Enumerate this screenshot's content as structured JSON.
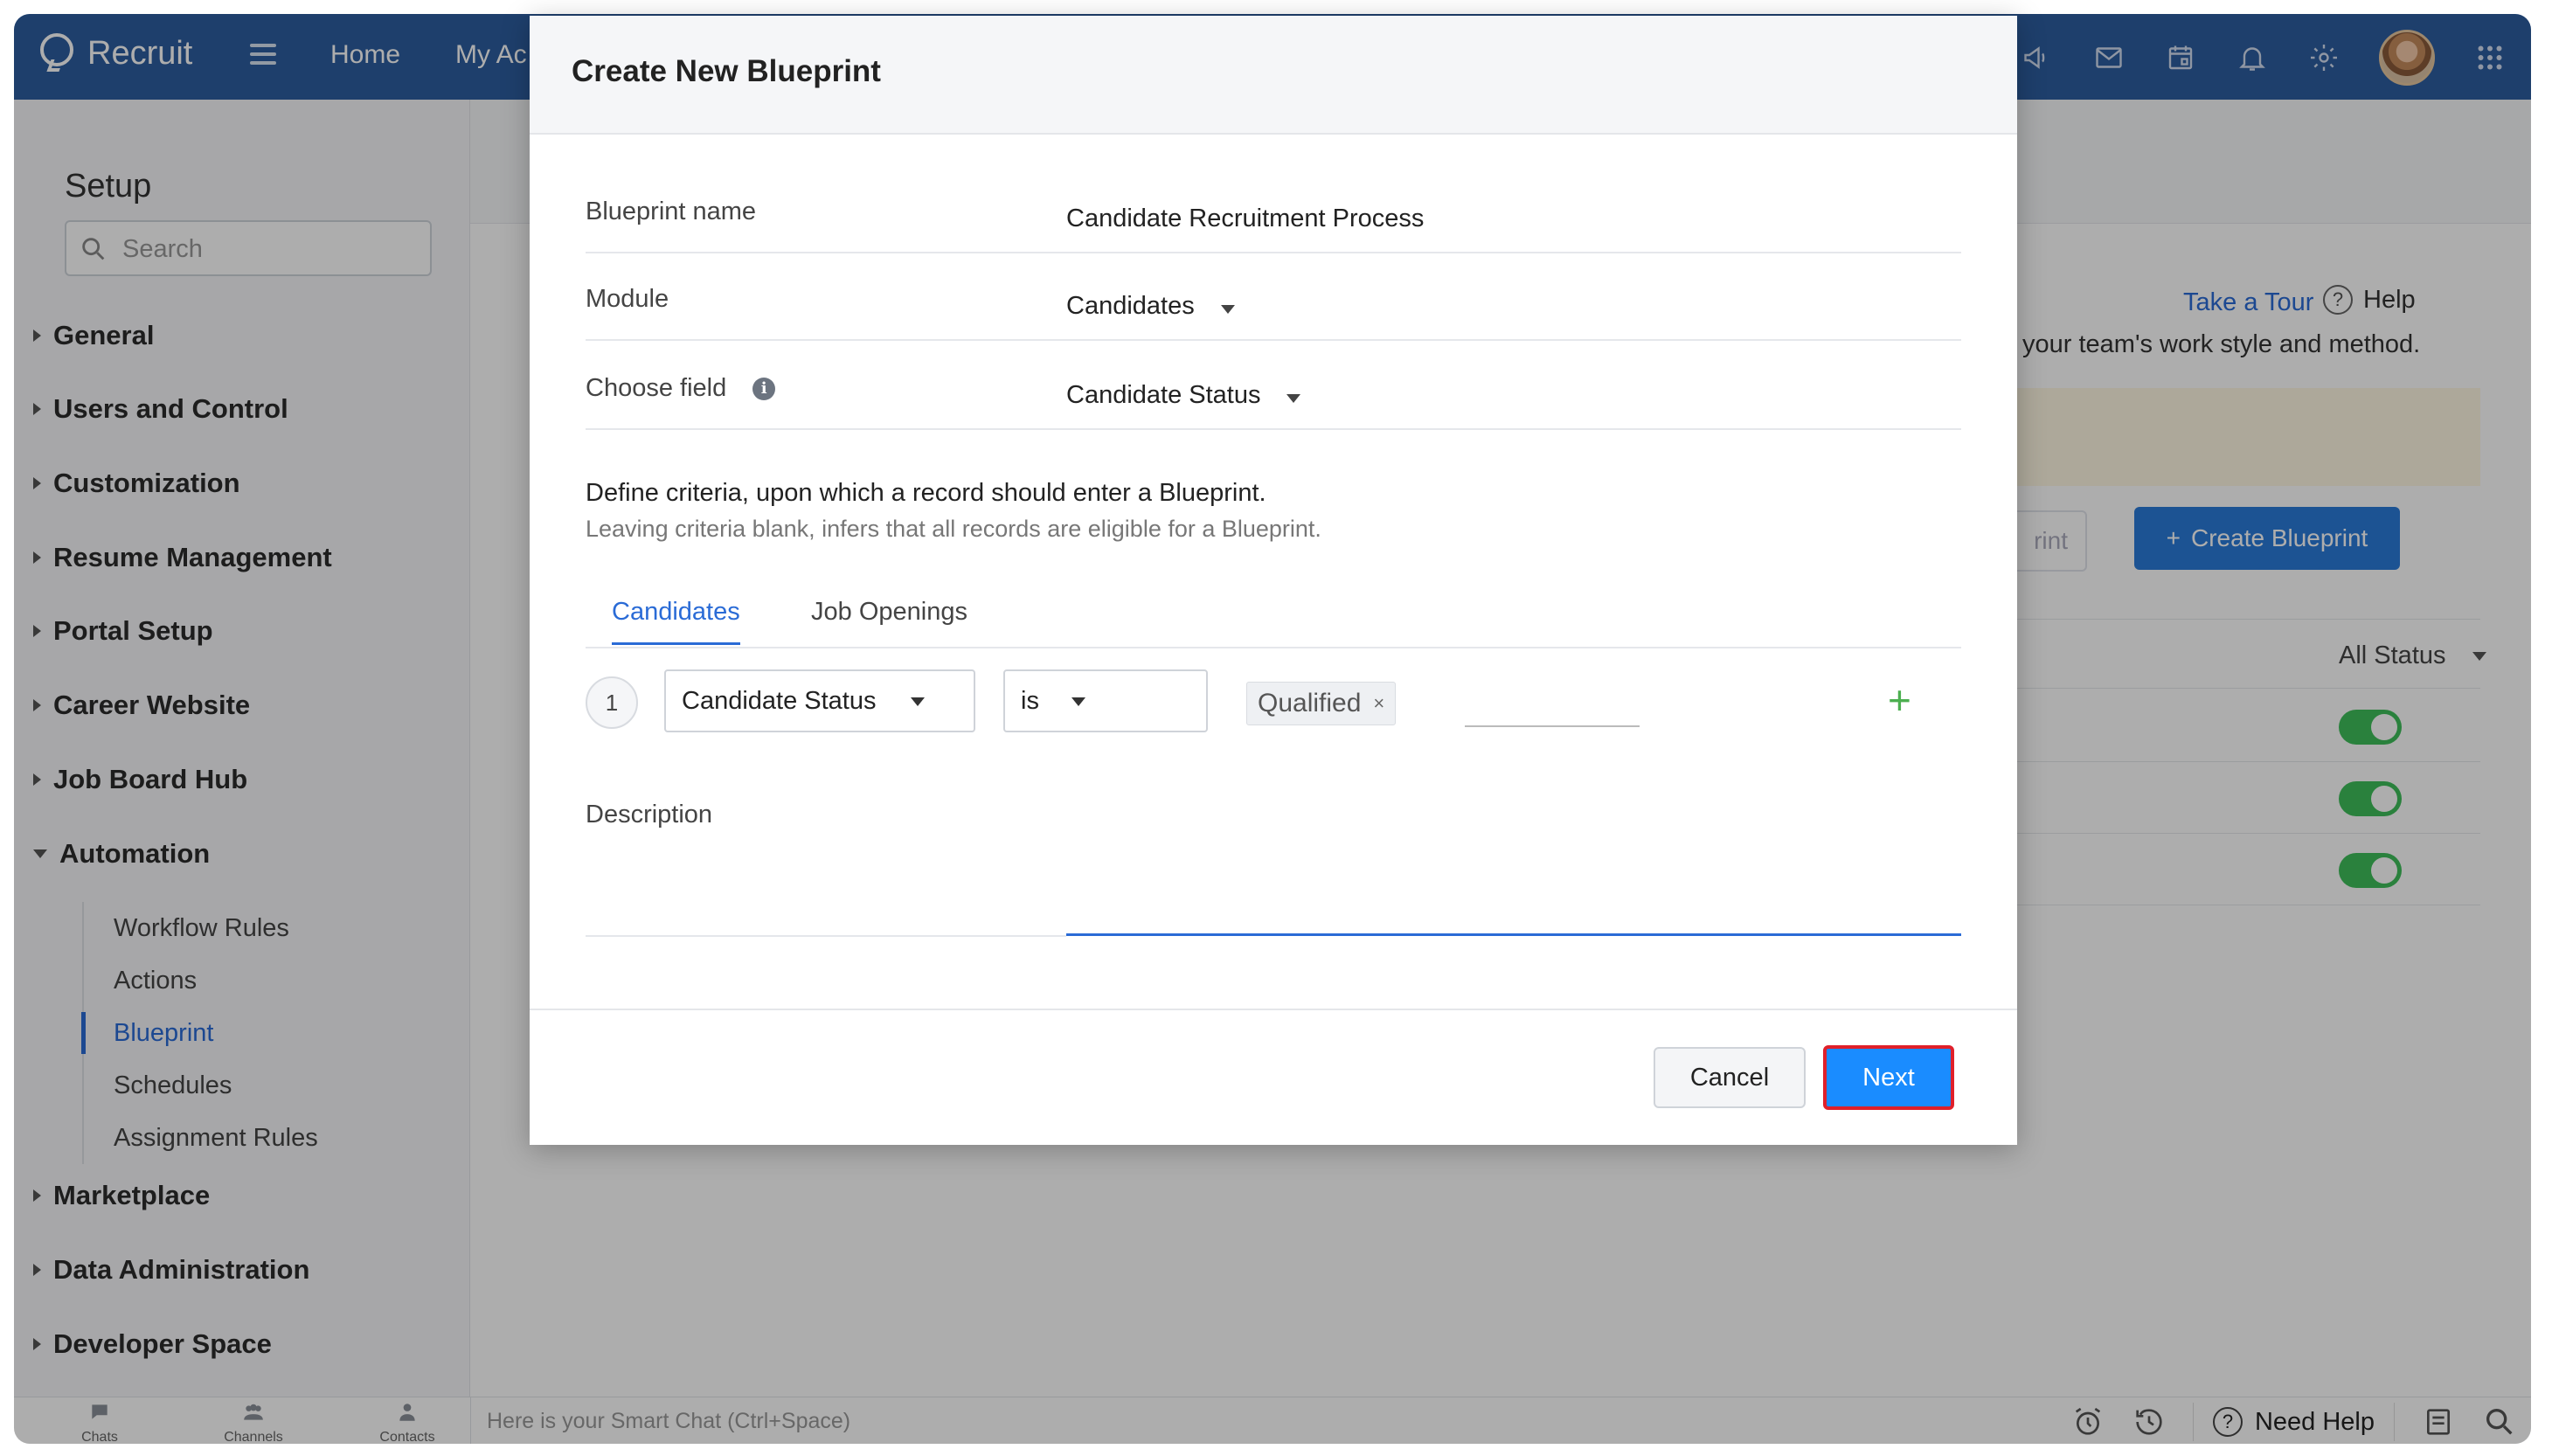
{
  "topbar": {
    "brand": "Recruit",
    "nav_links": [
      "Home",
      "My Ac"
    ]
  },
  "sidebar": {
    "title": "Setup",
    "search_placeholder": "Search",
    "groups": [
      "General",
      "Users and Control",
      "Customization",
      "Resume Management",
      "Portal Setup",
      "Career Website",
      "Job Board Hub",
      "Automation",
      "Marketplace",
      "Data Administration",
      "Developer Space"
    ],
    "automation_items": [
      "Workflow Rules",
      "Actions",
      "Blueprint",
      "Schedules",
      "Assignment Rules"
    ],
    "active_item": "Blueprint"
  },
  "main": {
    "take_tour": "Take a Tour",
    "help": "Help",
    "description": "your team's work style and method.",
    "ghost_button": "rint",
    "create_blueprint": "Create Blueprint",
    "status_filter": "All Status"
  },
  "modal": {
    "title": "Create New Blueprint",
    "fields": {
      "name_label": "Blueprint name",
      "name_value": "Candidate Recruitment Process",
      "module_label": "Module",
      "module_value": "Candidates",
      "field_label": "Choose field",
      "field_value": "Candidate Status"
    },
    "criteria_text": "Define criteria, upon which a record should enter a Blueprint.",
    "criteria_sub": "Leaving criteria blank, infers that all records are eligible for a Blueprint.",
    "tabs": [
      "Candidates",
      "Job Openings"
    ],
    "criteria_row": {
      "number": "1",
      "field": "Candidate Status",
      "operator": "is",
      "value_chip": "Qualified",
      "chip_remove": "×",
      "add": "+"
    },
    "description_label": "Description",
    "cancel": "Cancel",
    "next": "Next"
  },
  "bottombar": {
    "tabs": [
      "Chats",
      "Channels",
      "Contacts"
    ],
    "smart_chat_placeholder": "Here is your Smart Chat (Ctrl+Space)",
    "need_help": "Need Help"
  },
  "colors": {
    "topbar": "#2d5e9f",
    "accent": "#2a6bd6",
    "next_button": "#1a8cff",
    "next_highlight": "#e0202a",
    "toggle_on": "#3fbf5a"
  }
}
